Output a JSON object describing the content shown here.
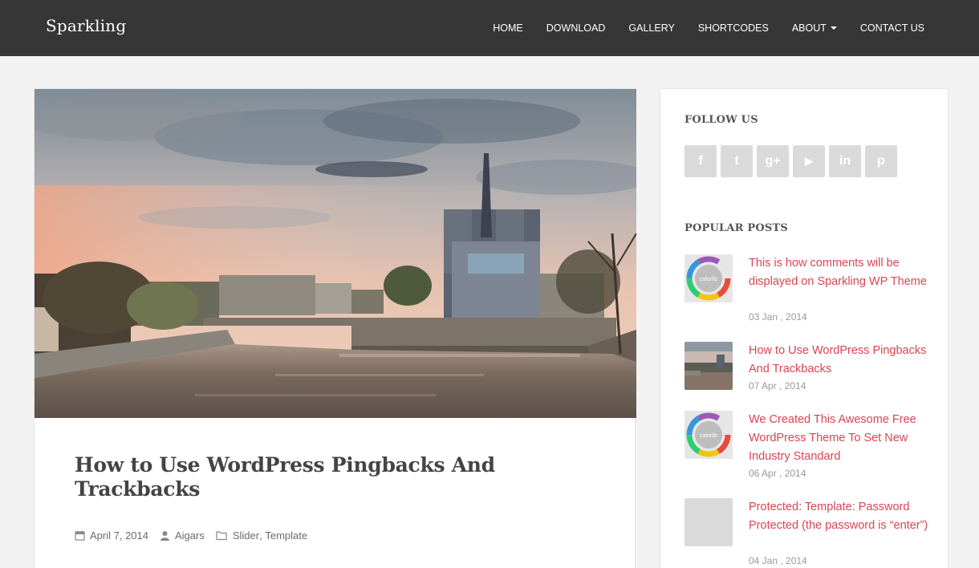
{
  "site": {
    "brand": "Sparkling"
  },
  "nav": {
    "items": [
      {
        "label": "HOME"
      },
      {
        "label": "DOWNLOAD"
      },
      {
        "label": "GALLERY"
      },
      {
        "label": "SHORTCODES"
      },
      {
        "label": "ABOUT",
        "dropdown": true
      },
      {
        "label": "CONTACT US"
      }
    ]
  },
  "post": {
    "title": "How to Use WordPress Pingbacks And Trackbacks",
    "date": "April 7, 2014",
    "author": "Aigars",
    "category_1": "Slider",
    "category_sep": ",",
    "category_2": "Template",
    "icons": [
      "calendar-icon",
      "user-icon",
      "folder-icon"
    ]
  },
  "sidebar": {
    "follow_title": "FOLLOW US",
    "social": [
      {
        "icon": "facebook-icon",
        "glyph": "f"
      },
      {
        "icon": "twitter-icon",
        "glyph": "t"
      },
      {
        "icon": "google-plus-icon",
        "glyph": "g+"
      },
      {
        "icon": "youtube-icon",
        "glyph": "▶"
      },
      {
        "icon": "linkedin-icon",
        "glyph": "in"
      },
      {
        "icon": "pinterest-icon",
        "glyph": "p"
      }
    ],
    "popular_title": "POPULAR POSTS",
    "popular": [
      {
        "title": "This is how comments will be displayed on Sparkling WP Theme",
        "date": "03 Jan , 2014",
        "thumb": "colorlib"
      },
      {
        "title": "How to Use WordPress Pingbacks And Trackbacks",
        "date": "07 Apr , 2014",
        "thumb": "photo"
      },
      {
        "title": "We Created This Awesome Free WordPress Theme To Set New Industry Standard",
        "date": "06 Apr , 2014",
        "thumb": "colorlib"
      },
      {
        "title": "Protected: Template: Password Protected (the password is “enter”)",
        "date": "04 Jan , 2014",
        "thumb": "blank"
      }
    ],
    "colorlib_label": "colorlib"
  },
  "colors": {
    "navbar": "#363636",
    "accent": "#da4453",
    "background": "#f2f2f2",
    "social_bg": "#dadada"
  }
}
